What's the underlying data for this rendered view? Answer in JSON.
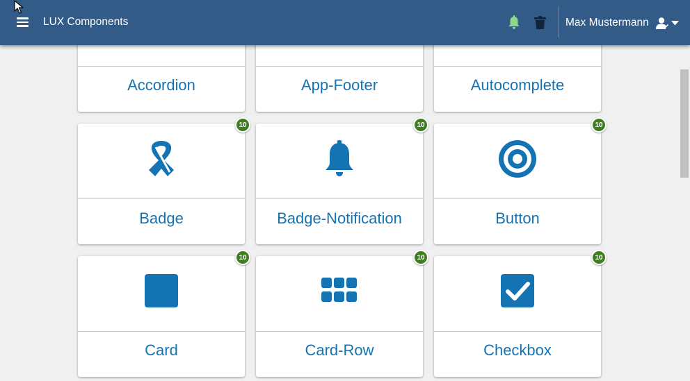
{
  "header": {
    "title": "LUX Components",
    "user_name": "Max Mustermann"
  },
  "colors": {
    "header_bg": "#335b87",
    "accent": "#1473b3",
    "badge_bg": "#3f7d1e",
    "notification_icon": "#8fd88a"
  },
  "icons": {
    "menu": "hamburger-menu-icon",
    "notification": "bell-icon",
    "delete": "trash-icon",
    "user": "user-icon",
    "dropdown": "caret-down-icon"
  },
  "components": [
    {
      "label": "Accordion",
      "badge": ""
    },
    {
      "label": "App-Footer",
      "badge": ""
    },
    {
      "label": "Autocomplete",
      "badge": ""
    },
    {
      "label": "Badge",
      "badge": "10",
      "icon": "ribbon-icon"
    },
    {
      "label": "Badge-Notification",
      "badge": "10",
      "icon": "bell-icon"
    },
    {
      "label": "Button",
      "badge": "10",
      "icon": "target-icon"
    },
    {
      "label": "Card",
      "badge": "10",
      "icon": "square-icon"
    },
    {
      "label": "Card-Row",
      "badge": "10",
      "icon": "grid-icon"
    },
    {
      "label": "Checkbox",
      "badge": "10",
      "icon": "checkbox-icon"
    }
  ]
}
